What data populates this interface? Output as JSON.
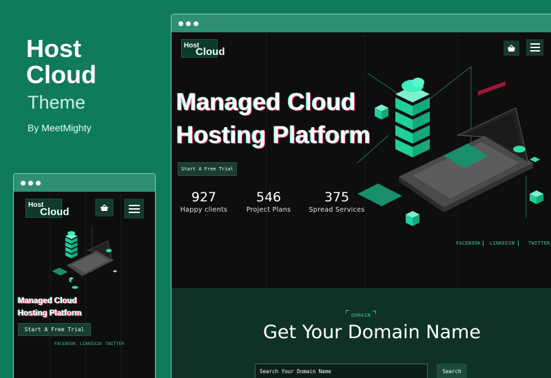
{
  "promo": {
    "title": "Host Cloud",
    "subtitle": "Theme",
    "author": "By MeetMighty"
  },
  "site": {
    "logo": {
      "line1": "Host",
      "line2": "Cloud"
    },
    "header_icons": [
      "basket-icon",
      "hamburger-menu-icon"
    ],
    "hero": {
      "title_line1": "Managed Cloud",
      "title_line2": "Hosting Platform",
      "cta": "Start A Free Trial"
    },
    "stats": [
      {
        "value": "927",
        "label": "Happy clients"
      },
      {
        "value": "546",
        "label": "Project Plans"
      },
      {
        "value": "375",
        "label": "Spread Services"
      }
    ],
    "social": [
      "FACEBOOK",
      "LINKEDIN",
      "TWITTER"
    ],
    "domain": {
      "tag": "DOMAIN",
      "title": "Get Your Domain Name",
      "search_placeholder": "Search Your Domain Name",
      "search_button": "Search"
    }
  },
  "colors": {
    "background": "#0f7a5c",
    "accent": "#37c79a",
    "dark": "#0e0e0e"
  }
}
